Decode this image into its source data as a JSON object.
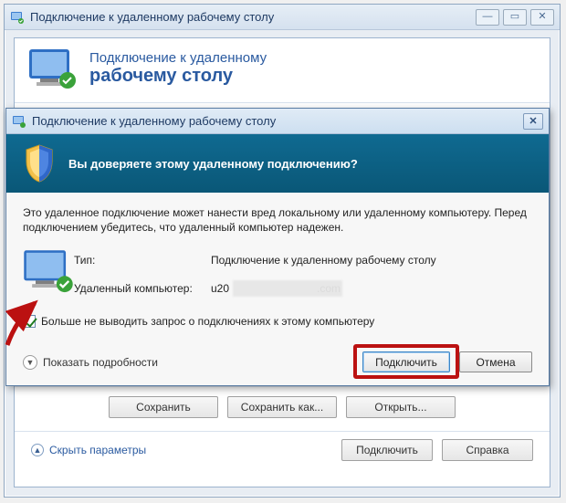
{
  "bg_window": {
    "title": "Подключение к удаленному рабочему столу",
    "header_line1": "Подключение к удаленному",
    "header_line2": "рабочему столу",
    "buttons": {
      "save": "Сохранить",
      "save_as": "Сохранить как...",
      "open": "Открыть..."
    },
    "hide_params": "Скрыть параметры",
    "connect": "Подключить",
    "help": "Справка"
  },
  "dialog": {
    "title": "Подключение к удаленному рабочему столу",
    "band_question": "Вы доверяете этому удаленному подключению?",
    "body_text": "Это удаленное подключение может нанести вред локальному или удаленному компьютеру. Перед подключением убедитесь, что удаленный компьютер надежен.",
    "type_label": "Тип:",
    "type_value": "Подключение к удаленному рабочему столу",
    "remote_label": "Удаленный компьютер:",
    "remote_value_visible_prefix": "u20",
    "remote_value_visible_suffix": ".com",
    "dont_ask_label": "Больше не выводить запрос о подключениях к этому компьютеру",
    "dont_ask_checked": true,
    "show_details": "Показать подробности",
    "connect": "Подключить",
    "cancel": "Отмена"
  },
  "annotation": {
    "highlight_target": "connect-button",
    "arrow_points_to": "dont-ask-checkbox"
  }
}
